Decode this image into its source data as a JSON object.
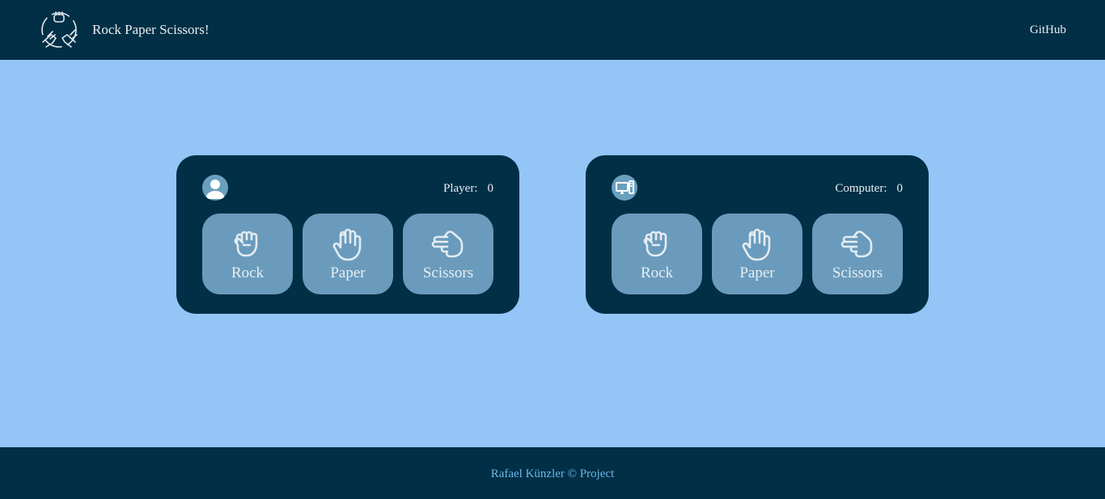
{
  "header": {
    "title": "Rock Paper Scissors!",
    "github_label": "GitHub",
    "logo_icon": "hands-rock-paper-scissors-icon"
  },
  "player": {
    "label": "Player:",
    "score": "0",
    "avatar_icon": "user-icon",
    "choices": [
      {
        "label": "Rock",
        "icon": "fist-icon"
      },
      {
        "label": "Paper",
        "icon": "open-hand-icon"
      },
      {
        "label": "Scissors",
        "icon": "scissors-hand-icon"
      }
    ]
  },
  "computer": {
    "label": "Computer:",
    "score": "0",
    "avatar_icon": "computer-icon",
    "choices": [
      {
        "label": "Rock",
        "icon": "fist-icon"
      },
      {
        "label": "Paper",
        "icon": "open-hand-icon"
      },
      {
        "label": "Scissors",
        "icon": "scissors-hand-icon"
      }
    ]
  },
  "footer": {
    "text": "Rafael Künzler © Project"
  },
  "colors": {
    "background": "#94c5f7",
    "dark": "#012f46",
    "button": "#6a9bbc",
    "footer_text": "#6ab7ea"
  }
}
